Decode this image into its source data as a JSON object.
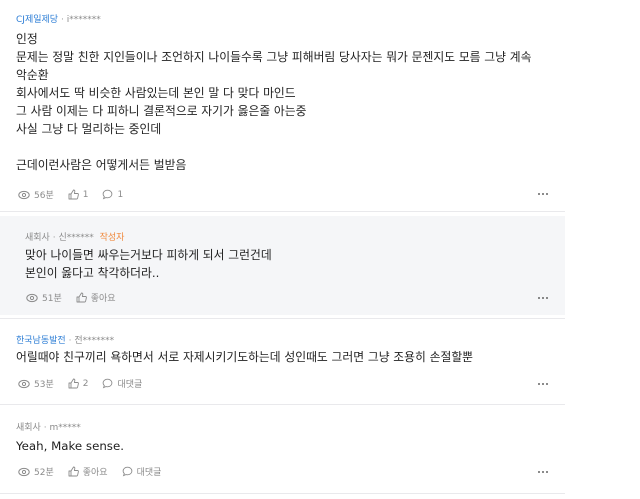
{
  "comments": [
    {
      "company": "CJ제일제당",
      "separator": "·",
      "user": "i*******",
      "lines": [
        "인정",
        "문제는 정말 친한 지인들이나 조언하지 나이들수록 그냥 피해버림 당사자는 뭐가 문젠지도 모름 그냥 계속",
        "악순환",
        "회사에서도 딱 비슷한 사람있는데 본인 말 다 맞다 마인드",
        "그 사람 이제는 다 피하니 결론적으로 자기가 옳은줄 아는중",
        "사실 그냥 다 멀리하는 중인데",
        "",
        "근데이런사람은 어떻게서든 벌받음"
      ],
      "time": "56분",
      "likes": "1",
      "replies": "1"
    },
    {
      "company": "새회사",
      "separator": "·",
      "user": "신******",
      "author_tag": "작성자",
      "lines": [
        "맞아 나이들면 싸우는거보다 피하게 되서 그런건데",
        "본인이 옳다고 착각하더라.."
      ],
      "time": "51분",
      "like_label": "좋아요"
    },
    {
      "company": "한국남동발전",
      "separator": "·",
      "user": "전*******",
      "lines": [
        "어릴때야 친구끼리 욕하면서 서로 자제시키기도하는데 성인때도 그러면 그냥 조용히 손절할뿐"
      ],
      "time": "53분",
      "likes": "2",
      "reply_label": "대댓글"
    },
    {
      "company": "새회사",
      "separator": "·",
      "user": "m*****",
      "lines": [
        "Yeah, Make sense."
      ],
      "time": "52분",
      "like_label": "좋아요",
      "reply_label": "대댓글"
    }
  ],
  "icons": {
    "views": "eye-icon",
    "like": "thumbs-up-icon",
    "reply": "speech-bubble-icon",
    "more": "more-dots-icon"
  },
  "colors": {
    "company_link": "#2f7fd6",
    "author_tag": "#f08a3e",
    "meta_gray": "#8b8b8b",
    "reply_bg": "#f5f6f8"
  }
}
